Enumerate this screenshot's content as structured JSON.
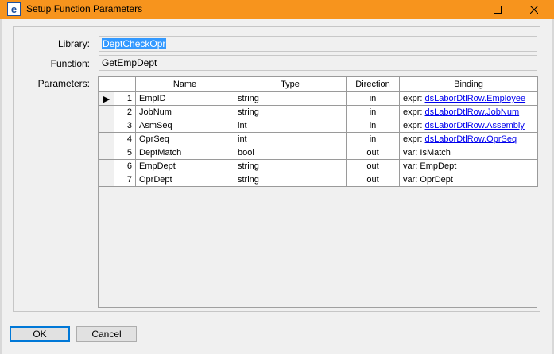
{
  "window": {
    "title": "Setup Function Parameters",
    "app_icon_letter": "e"
  },
  "form": {
    "library_label": "Library:",
    "library_value": "DeptCheckOpr",
    "function_label": "Function:",
    "function_value": "GetEmpDept",
    "parameters_label": "Parameters:"
  },
  "grid": {
    "columns": [
      "Name",
      "Type",
      "Direction",
      "Binding"
    ],
    "rows": [
      {
        "num": "1",
        "name": "EmpID",
        "type": "string",
        "direction": "in",
        "binding_prefix": "expr: ",
        "binding_value": "dsLaborDtlRow.Employee",
        "is_link": true
      },
      {
        "num": "2",
        "name": "JobNum",
        "type": "string",
        "direction": "in",
        "binding_prefix": "expr: ",
        "binding_value": "dsLaborDtlRow.JobNum",
        "is_link": true
      },
      {
        "num": "3",
        "name": "AsmSeq",
        "type": "int",
        "direction": "in",
        "binding_prefix": "expr: ",
        "binding_value": "dsLaborDtlRow.Assembly",
        "is_link": true
      },
      {
        "num": "4",
        "name": "OprSeq",
        "type": "int",
        "direction": "in",
        "binding_prefix": "expr: ",
        "binding_value": "dsLaborDtlRow.OprSeq",
        "is_link": true
      },
      {
        "num": "5",
        "name": "DeptMatch",
        "type": "bool",
        "direction": "out",
        "binding_prefix": "var: ",
        "binding_value": "IsMatch",
        "is_link": false
      },
      {
        "num": "6",
        "name": "EmpDept",
        "type": "string",
        "direction": "out",
        "binding_prefix": "var: ",
        "binding_value": "EmpDept",
        "is_link": false
      },
      {
        "num": "7",
        "name": "OprDept",
        "type": "string",
        "direction": "out",
        "binding_prefix": "var: ",
        "binding_value": "OprDept",
        "is_link": false
      }
    ],
    "current_row_indicator": "▶"
  },
  "buttons": {
    "ok_label": "OK",
    "cancel_label": "Cancel"
  },
  "colors": {
    "titlebar": "#f7941d",
    "selection": "#3399ff",
    "link": "#0000ee",
    "ok_border": "#0078d7"
  }
}
